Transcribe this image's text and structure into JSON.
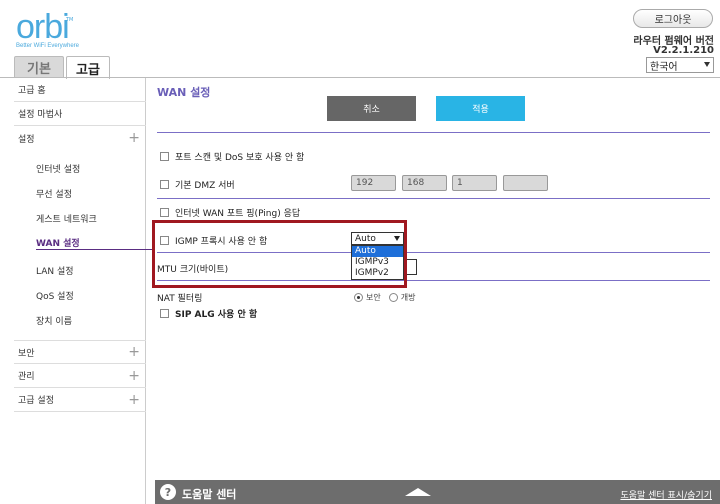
{
  "brand": {
    "logo": "orbi",
    "tagline": "Better WiFi Everywhere",
    "tm": "TM",
    "color": "#4aa9dd"
  },
  "tabs": [
    {
      "label": "기본"
    },
    {
      "label": "고급"
    }
  ],
  "header": {
    "logout": "로그아웃",
    "firmware_label": "라우터 펌웨어 버전",
    "firmware_version": "V2.2.1.210",
    "language": "한국어"
  },
  "sidebar": {
    "home": "고급 홈",
    "wizard": "설정 마법사",
    "setup": "설정",
    "setup_items": [
      "인터넷 설정",
      "무선 설정",
      "게스트 네트워크",
      "WAN 설정",
      "LAN 설정",
      "QoS 설정",
      "장치 이름"
    ],
    "security": "보안",
    "admin": "관리",
    "advanced_setup": "고급 설정",
    "plus": "+"
  },
  "main": {
    "title": "WAN 설정",
    "cancel": "취소",
    "apply": "적용",
    "port_scan": "포트 스캔 및 DoS 보호 사용 안 함",
    "dmz": "기본 DMZ 서버",
    "dmz_ip": [
      "192",
      "168",
      "1",
      ""
    ],
    "ping": "인터넷 WAN 포트 핑(Ping) 응답",
    "igmp": "IGMP 프록시 사용 안 함",
    "igmp_selected": "Auto",
    "igmp_options": [
      "Auto",
      "IGMPv3",
      "IGMPv2"
    ],
    "mtu": "MTU 크기(바이트)",
    "nat": "NAT 필터링",
    "nat_secure": "보안",
    "nat_open": "개방",
    "sip": "SIP ALG 사용 안 함"
  },
  "help": {
    "icon": "?",
    "title": "도움말 센터",
    "toggle": "도움말 센터 표시/숨기기"
  },
  "colors": {
    "accent": "#6a5fb8",
    "apply": "#29b4e5",
    "cancel": "#666666",
    "highlight": "#a01820",
    "active": "#5a2d82"
  }
}
